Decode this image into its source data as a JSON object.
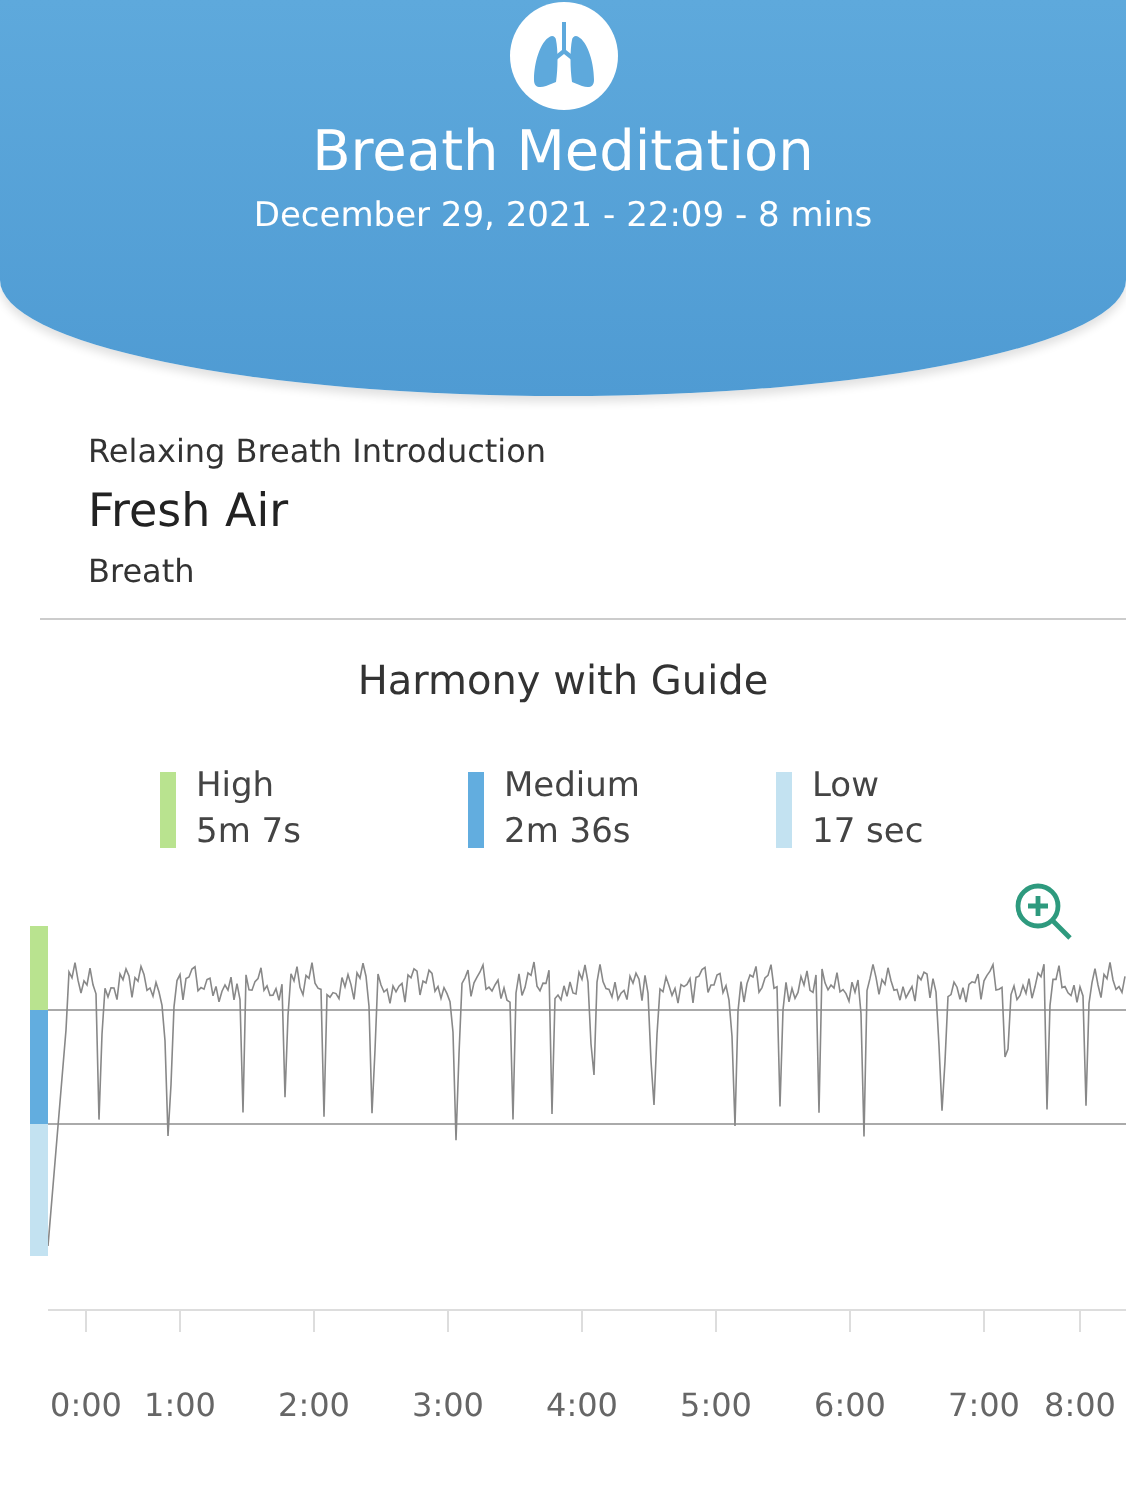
{
  "header": {
    "title": "Breath Meditation",
    "subtitle": "December 29, 2021 - 22:09 - 8 mins"
  },
  "session": {
    "series": "Relaxing Breath Introduction",
    "name": "Fresh Air",
    "category": "Breath"
  },
  "harmony": {
    "title": "Harmony with Guide",
    "legend": [
      {
        "label": "High",
        "value": "5m 7s",
        "color": "#b9e38f"
      },
      {
        "label": "Medium",
        "value": "2m 36s",
        "color": "#62addf"
      },
      {
        "label": "Low",
        "value": "17 sec",
        "color": "#c3e2f1"
      }
    ],
    "time_labels": [
      "0:00",
      "1:00",
      "2:00",
      "3:00",
      "4:00",
      "5:00",
      "6:00",
      "7:00",
      "8:00"
    ]
  }
}
